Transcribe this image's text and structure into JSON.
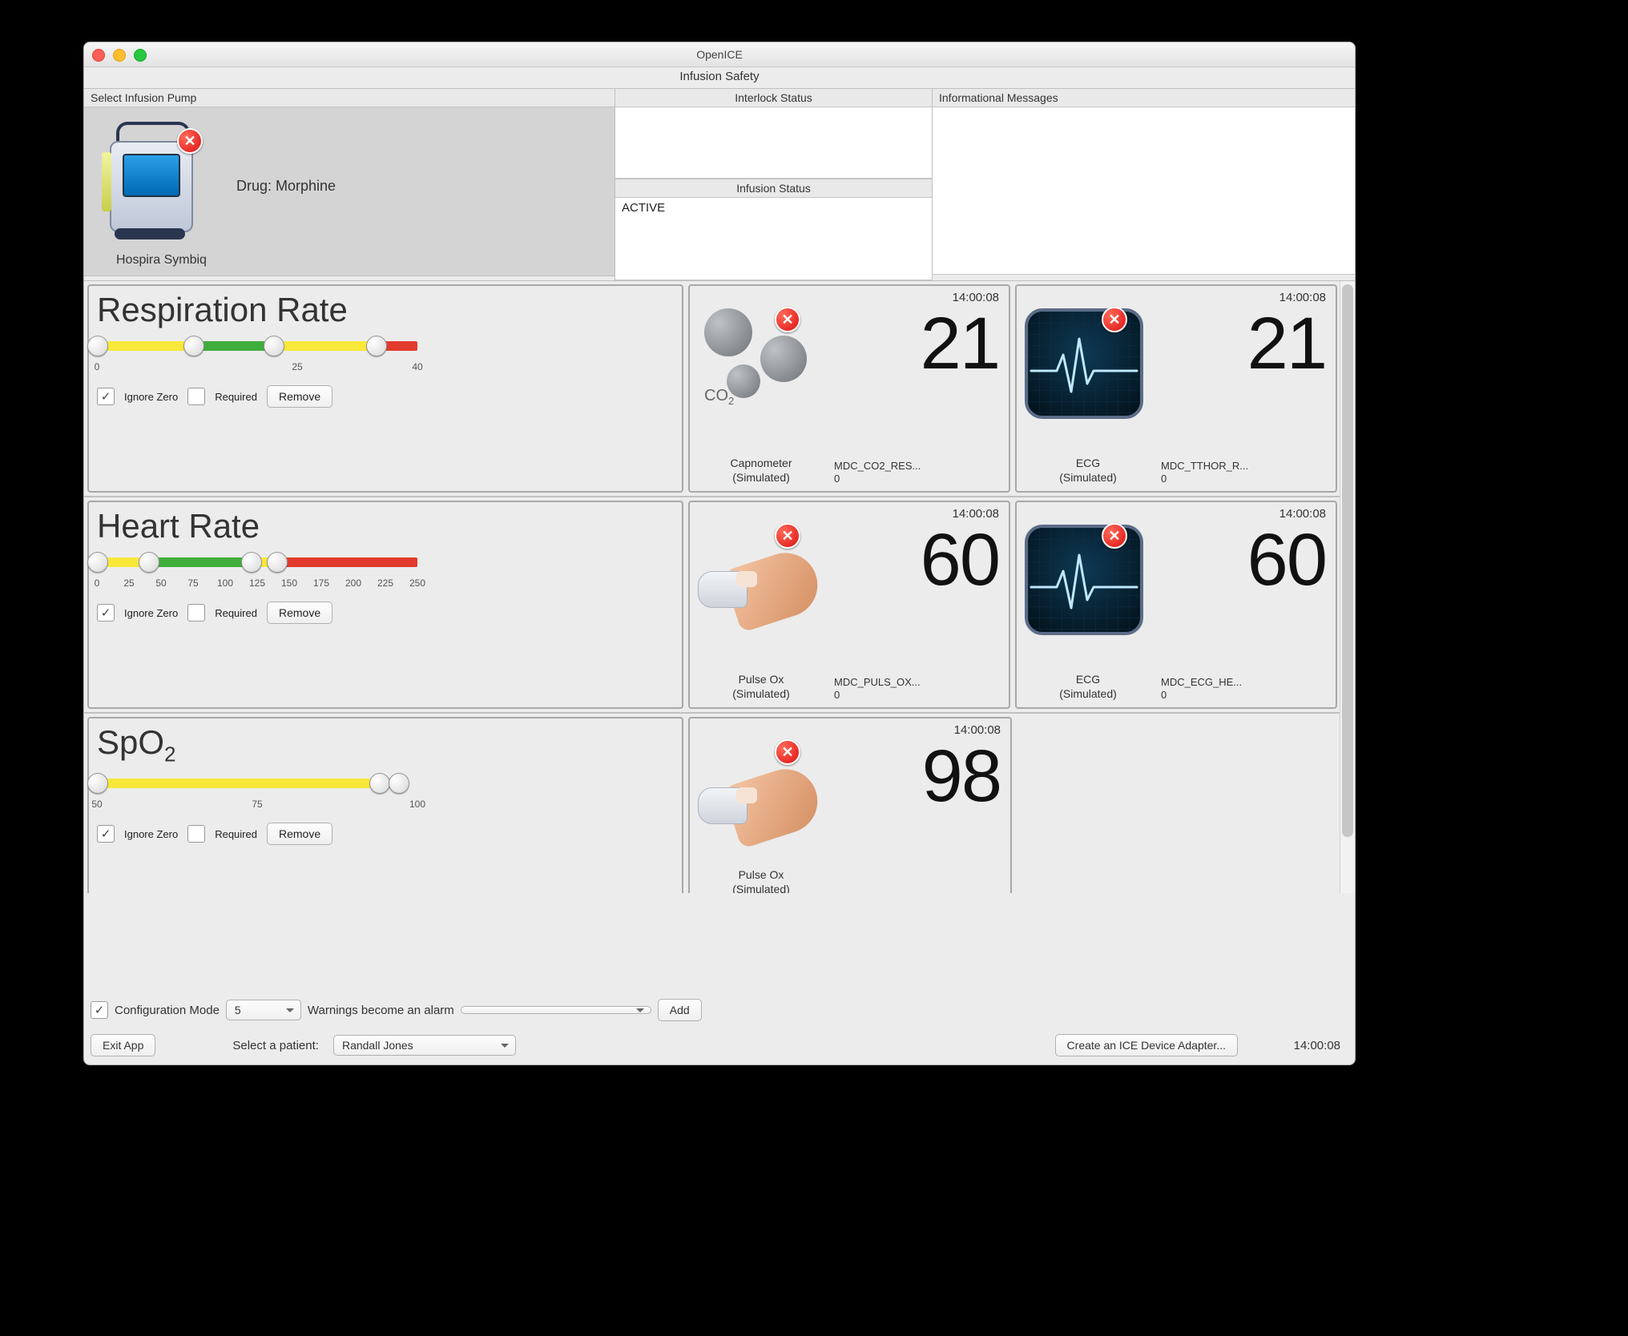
{
  "window": {
    "title": "OpenICE",
    "subtitle": "Infusion Safety"
  },
  "top": {
    "pump_header": "Select Infusion Pump",
    "interlock_header": "Interlock Status",
    "info_header": "Informational Messages",
    "infusion_header": "Infusion Status",
    "pump": {
      "name": "Hospira Symbiq",
      "drug_label": "Drug: Morphine"
    },
    "infusion_status": "ACTIVE"
  },
  "vitals": [
    {
      "title": "Respiration Rate",
      "ticks": [
        "0",
        "25",
        "40"
      ],
      "tick_pos_pct": [
        0,
        62.5,
        100
      ],
      "segments": [
        {
          "from": 0,
          "to": 30,
          "color": "#f7e83a"
        },
        {
          "from": 30,
          "to": 55,
          "color": "#3fae3a"
        },
        {
          "from": 55,
          "to": 87,
          "color": "#f7e83a"
        },
        {
          "from": 87,
          "to": 100,
          "color": "#e23b2e"
        }
      ],
      "knobs_pct": [
        0,
        30,
        55,
        87
      ],
      "ignore_zero": true,
      "required": false,
      "remove": "Remove",
      "cards": [
        {
          "icon": "co2",
          "timestamp": "14:00:08",
          "value": "21",
          "device": "Capnometer (Simulated)",
          "metric": "MDC_CO2_RES...",
          "sub": "0"
        },
        {
          "icon": "ecg",
          "timestamp": "14:00:08",
          "value": "21",
          "device": "ECG (Simulated)",
          "metric": "MDC_TTHOR_R...",
          "sub": "0"
        }
      ]
    },
    {
      "title": "Heart Rate",
      "ticks": [
        "0",
        "25",
        "50",
        "75",
        "100",
        "125",
        "150",
        "175",
        "200",
        "225",
        "250"
      ],
      "tick_pos_pct": [
        0,
        10,
        20,
        30,
        40,
        50,
        60,
        70,
        80,
        90,
        100
      ],
      "segments": [
        {
          "from": 0,
          "to": 16,
          "color": "#f7e83a"
        },
        {
          "from": 16,
          "to": 48,
          "color": "#3fae3a"
        },
        {
          "from": 48,
          "to": 56,
          "color": "#f7e83a"
        },
        {
          "from": 56,
          "to": 100,
          "color": "#e23b2e"
        }
      ],
      "knobs_pct": [
        0,
        16,
        48,
        56
      ],
      "ignore_zero": true,
      "required": false,
      "remove": "Remove",
      "cards": [
        {
          "icon": "po",
          "timestamp": "14:00:08",
          "value": "60",
          "device": "Pulse Ox (Simulated)",
          "metric": "MDC_PULS_OX...",
          "sub": "0"
        },
        {
          "icon": "ecg",
          "timestamp": "14:00:08",
          "value": "60",
          "device": "ECG (Simulated)",
          "metric": "MDC_ECG_HE...",
          "sub": "0"
        }
      ]
    },
    {
      "title_html": "SpO<sub>2</sub>",
      "title": "SpO2",
      "ticks": [
        "50",
        "75",
        "100"
      ],
      "tick_pos_pct": [
        0,
        50,
        100
      ],
      "segments": [
        {
          "from": 0,
          "to": 88,
          "color": "#f7e83a"
        },
        {
          "from": 88,
          "to": 94,
          "color": "#3fae3a"
        }
      ],
      "knobs_pct": [
        0,
        88,
        94
      ],
      "ignore_zero": true,
      "required": false,
      "remove": "Remove",
      "cards": [
        {
          "icon": "po",
          "timestamp": "14:00:08",
          "value": "98",
          "device": "Pulse Ox (Simulated)",
          "metric": "",
          "sub": ""
        },
        {
          "icon": "none"
        }
      ]
    }
  ],
  "labels": {
    "ignore_zero": "Ignore Zero",
    "required": "Required"
  },
  "config": {
    "mode_checked": true,
    "mode_label": "Configuration Mode",
    "warnings_count": "5",
    "warnings_text": "Warnings become an alarm",
    "alarm_select": "",
    "add": "Add"
  },
  "footer": {
    "exit": "Exit App",
    "select_patient_label": "Select a patient:",
    "patient": "Randall Jones",
    "create_adapter": "Create an ICE Device Adapter...",
    "clock": "14:00:08"
  }
}
